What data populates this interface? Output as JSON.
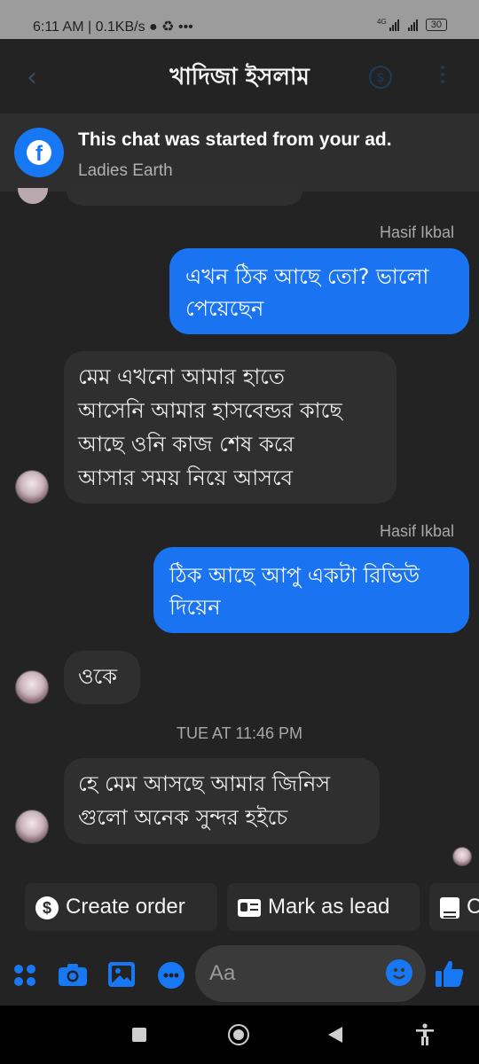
{
  "status_bar": {
    "time": "6:11 AM",
    "speed": "0.1KB/s",
    "extra": "•••",
    "network": "4G",
    "battery": "30"
  },
  "header": {
    "title": "খাদিজা ইসলাম"
  },
  "ad_banner": {
    "title": "This chat was started from your ad.",
    "subtitle": "Ladies Earth"
  },
  "messages": [
    {
      "direction": "outgoing",
      "sender": "Hasif Ikbal",
      "lines": [
        "এখন ঠিক আছে তো? ভালো",
        "পেয়েছেন"
      ]
    },
    {
      "direction": "incoming",
      "lines": [
        "মেম এখনো আমার হাতে",
        "আসেনি আমার হাসবেন্ডর কাছে",
        "আছে ওনি কাজ শেষ করে",
        "আসার সময় নিয়ে আসবে"
      ]
    },
    {
      "direction": "outgoing",
      "sender": "Hasif Ikbal",
      "lines": [
        "ঠিক আছে আপু একটা রিভিউ",
        "দিয়েন"
      ]
    },
    {
      "direction": "incoming",
      "lines": [
        "ওকে"
      ]
    },
    {
      "direction": "incoming",
      "lines": [
        "হে মেম আসছে আমার জিনিস",
        "গুলো অনেক সুন্দর হইচে"
      ]
    }
  ],
  "timestamp": "TUE AT 11:46 PM",
  "quick_actions": [
    {
      "label": "Create order",
      "icon": "dollar-circle-icon"
    },
    {
      "label": "Mark as lead",
      "icon": "contact-card-icon"
    },
    {
      "label": "C",
      "icon": "document-icon"
    }
  ],
  "composer": {
    "placeholder": "Aa"
  },
  "colors": {
    "accent": "#1877f2",
    "outgoing_bubble": "#1a73f0",
    "incoming_bubble": "#2f2f2f",
    "background": "#232323"
  }
}
